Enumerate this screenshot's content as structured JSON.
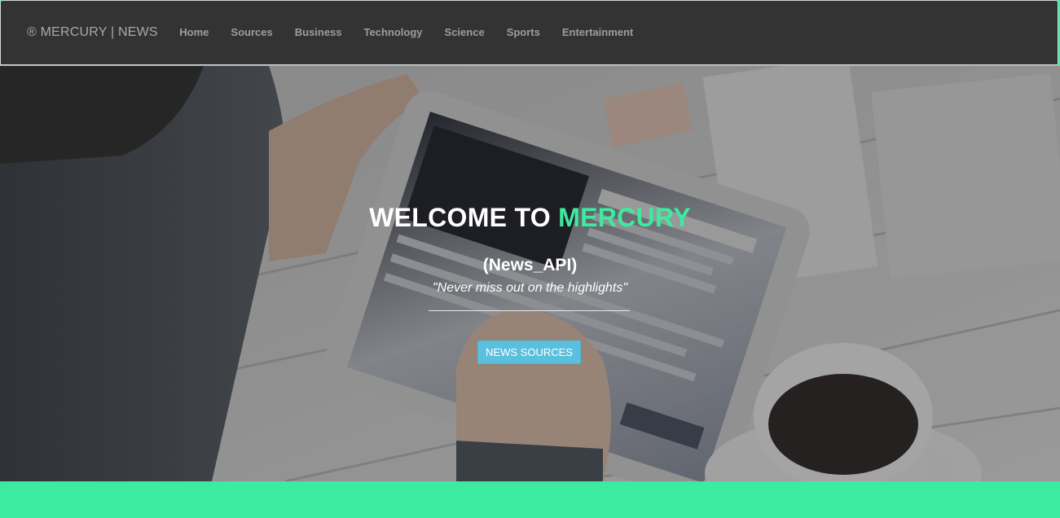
{
  "brand": {
    "label": "® MERCURY | NEWS"
  },
  "nav": {
    "items": [
      {
        "label": "Home"
      },
      {
        "label": "Sources"
      },
      {
        "label": "Business"
      },
      {
        "label": "Technology"
      },
      {
        "label": "Science"
      },
      {
        "label": "Sports"
      },
      {
        "label": "Entertainment"
      }
    ]
  },
  "hero": {
    "headline_prefix": "WELCOME TO ",
    "headline_accent": "MERCURY",
    "subtitle": "(News_API)",
    "tagline": "\"Never miss out on the highlights\"",
    "button_label": "NEWS SOURCES"
  },
  "colors": {
    "navbar_bg": "#333333",
    "accent": "#3deba0",
    "button": "#5bc0de",
    "nav_text": "#9d9d9d"
  }
}
